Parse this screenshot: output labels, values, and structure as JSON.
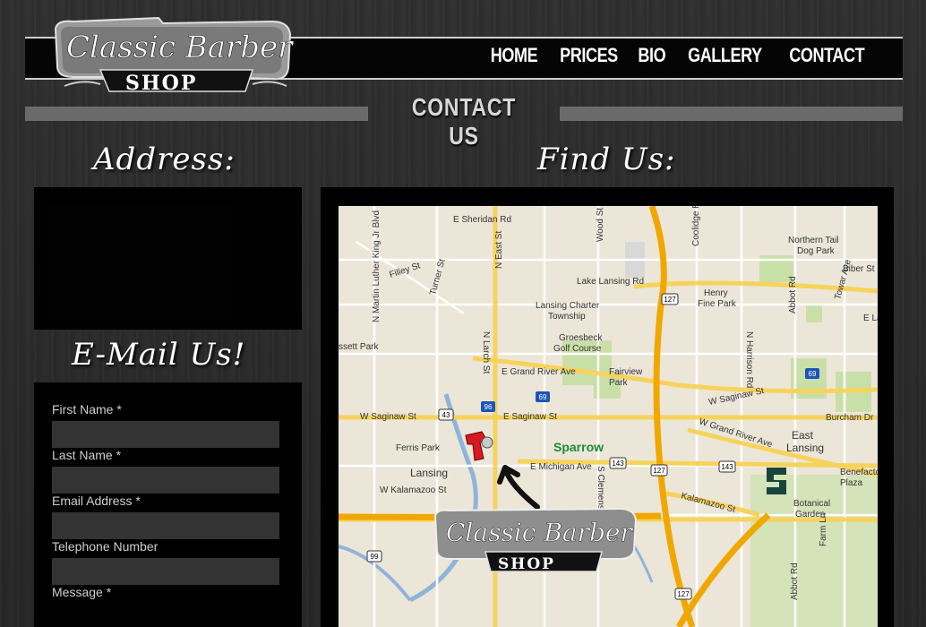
{
  "brand": {
    "logo_line1": "Classic Barber",
    "logo_line2": "SHOP"
  },
  "nav": {
    "items": [
      {
        "label": "HOME"
      },
      {
        "label": "PRICES"
      },
      {
        "label": "BIO"
      },
      {
        "label": "GALLERY"
      },
      {
        "label": "CONTACT"
      }
    ]
  },
  "page": {
    "title": "CONTACT US"
  },
  "address": {
    "heading": "Address:"
  },
  "email": {
    "heading": "E-Mail Us!",
    "fields": [
      {
        "label": "First Name *"
      },
      {
        "label": "Last Name *"
      },
      {
        "label": "Email Address *"
      },
      {
        "label": "Telephone Number"
      },
      {
        "label": "Message *"
      }
    ]
  },
  "findus": {
    "heading": "Find Us:"
  },
  "map": {
    "labels": [
      "E Sheridan Rd",
      "N East St",
      "N Martin Luther King Jr Blvd",
      "Filley St",
      "Turner St",
      "Wood St",
      "Lake Lansing Rd",
      "Coolidge Rd",
      "Northern Tail Dog Park",
      "Biber St",
      "Towar Ave",
      "Henry Fine Park",
      "Abbot Rd",
      "Lansing Charter Township",
      "Groesbeck Golf Course",
      "Fairview Park",
      "N Larch St",
      "E Grand River Ave",
      "N Harrison Rd",
      "Sassett Park",
      "W Saginaw St",
      "E Saginaw St",
      "W Saginaw St",
      "Burcham Dr",
      "W Grand River Ave",
      "Ferris Park",
      "Sparrow",
      "East Lansing",
      "Lansing",
      "E Michigan Ave",
      "Benefactor Plaza",
      "W Kalamazoo St",
      "S Clemens Ave",
      "Kalamazoo St",
      "Botanical Garden",
      "Farm Ln",
      "Abbot Rd",
      "E Lake"
    ],
    "routes": [
      "127",
      "69",
      "96",
      "43",
      "143",
      "127",
      "143",
      "69",
      "99",
      "127"
    ],
    "overlay_logo_line1": "Classic Barber",
    "overlay_logo_line2": "SHOP",
    "hospital_name": "Sparrow"
  }
}
